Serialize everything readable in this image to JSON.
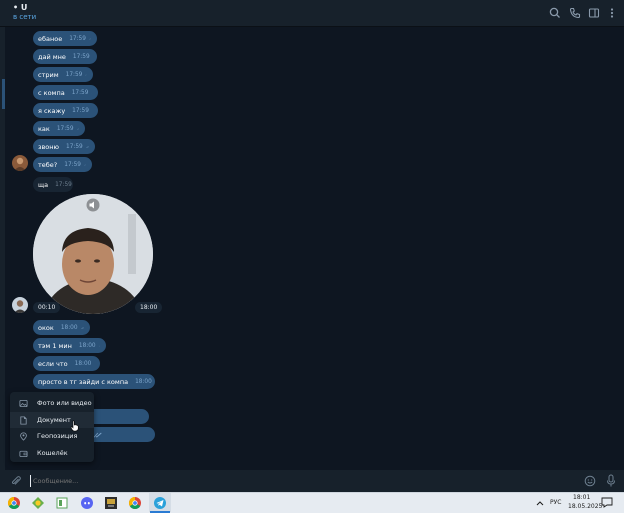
{
  "header": {
    "contact_name": "• U",
    "status": "в сети",
    "icons": [
      "search-icon",
      "phone-icon",
      "sidebar-toggle-icon",
      "more-vertical-icon"
    ]
  },
  "messages": [
    {
      "text": "ебаное",
      "time": "17:59",
      "type": "out"
    },
    {
      "text": "дай мне",
      "time": "17:59",
      "type": "out"
    },
    {
      "text": "стрим",
      "time": "17:59",
      "type": "out"
    },
    {
      "text": "с компа",
      "time": "17:59",
      "type": "out"
    },
    {
      "text": "я скажу",
      "time": "17:59",
      "type": "out"
    },
    {
      "text": "как",
      "time": "17:59",
      "type": "out"
    },
    {
      "text": "звоню",
      "time": "17:59",
      "type": "out"
    },
    {
      "text": "тебе?",
      "time": "17:59",
      "type": "out"
    },
    {
      "text": "ща",
      "time": "17:59",
      "type": "in"
    },
    {
      "text": "окок",
      "time": "18:00",
      "type": "out"
    },
    {
      "text": "тэм 1 мин",
      "time": "18:00",
      "type": "out"
    },
    {
      "text": "если что",
      "time": "18:00",
      "type": "out"
    },
    {
      "text": "просто в тг зайди с компа",
      "time": "18:00",
      "type": "out"
    },
    {
      "text": "в чат",
      "time": "18:00",
      "type": "out"
    },
    {
      "text": "ть файл",
      "time": "18:00",
      "type": "out"
    }
  ],
  "video_message": {
    "duration": "00:10",
    "time": "18:00"
  },
  "attach_menu": {
    "items": [
      {
        "label": "Фото или видео",
        "icon": "photo-icon"
      },
      {
        "label": "Документ",
        "icon": "document-icon"
      },
      {
        "label": "Геопозиция",
        "icon": "location-icon"
      },
      {
        "label": "Кошелёк",
        "icon": "wallet-icon"
      }
    ]
  },
  "composer": {
    "placeholder": "Сообщение..."
  },
  "taskbar": {
    "apps": [
      "chrome-icon",
      "yandex-icon",
      "files-icon",
      "discord-icon",
      "game-icon",
      "chrome-alt-icon",
      "telegram-icon"
    ],
    "language": "РУС",
    "time": "18:01",
    "date": "18.05.2025"
  },
  "colors": {
    "bg": "#0e1621",
    "panel": "#17212b",
    "out_bubble": "#2b5278",
    "in_bubble": "#182533",
    "accent": "#5ca9e6"
  }
}
